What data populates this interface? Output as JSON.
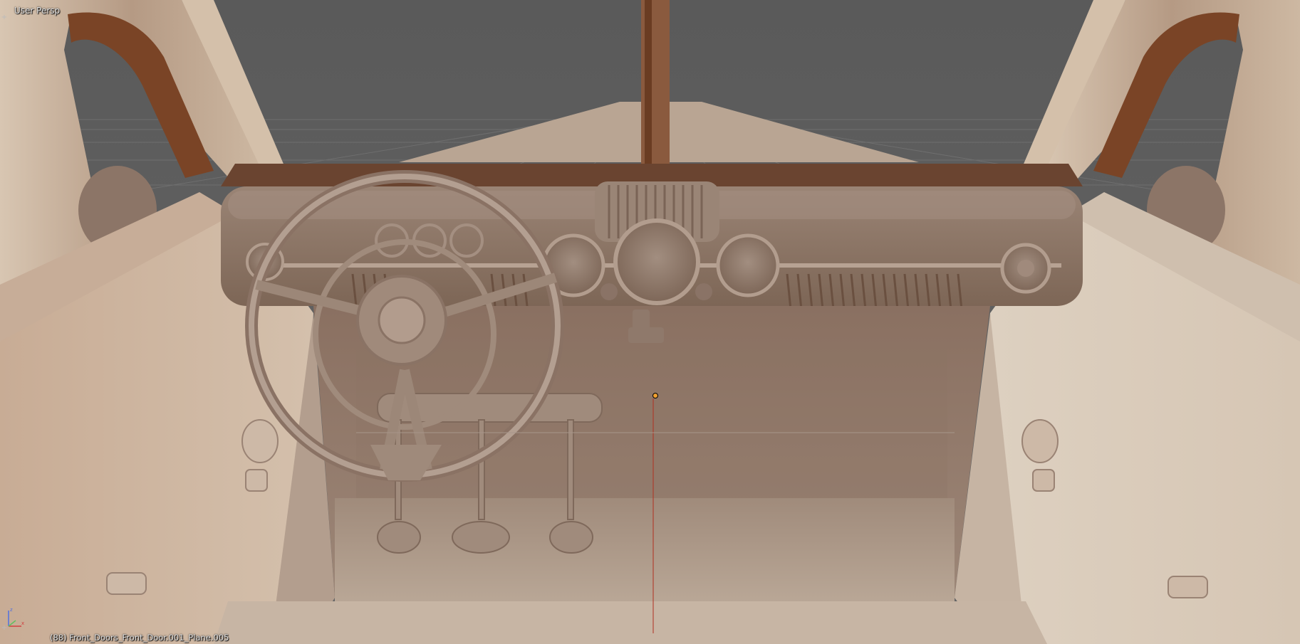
{
  "viewport": {
    "view_label": "User Persp",
    "object_info": "(88) Front_Doors_Front_Door.001_Plane.005",
    "icons": [
      "view-corner-plus-icon",
      "view-corner-plus-icon",
      "axis-gizmo-icon"
    ],
    "colors": {
      "background": "#5f5f5f",
      "grid": "#6e6e6e",
      "clay_light": "#cbb8a4",
      "clay_mid": "#9c8574",
      "clay_dark": "#5a3a28",
      "accent_origin": "#f0a030",
      "axis_line": "#b03020"
    }
  }
}
